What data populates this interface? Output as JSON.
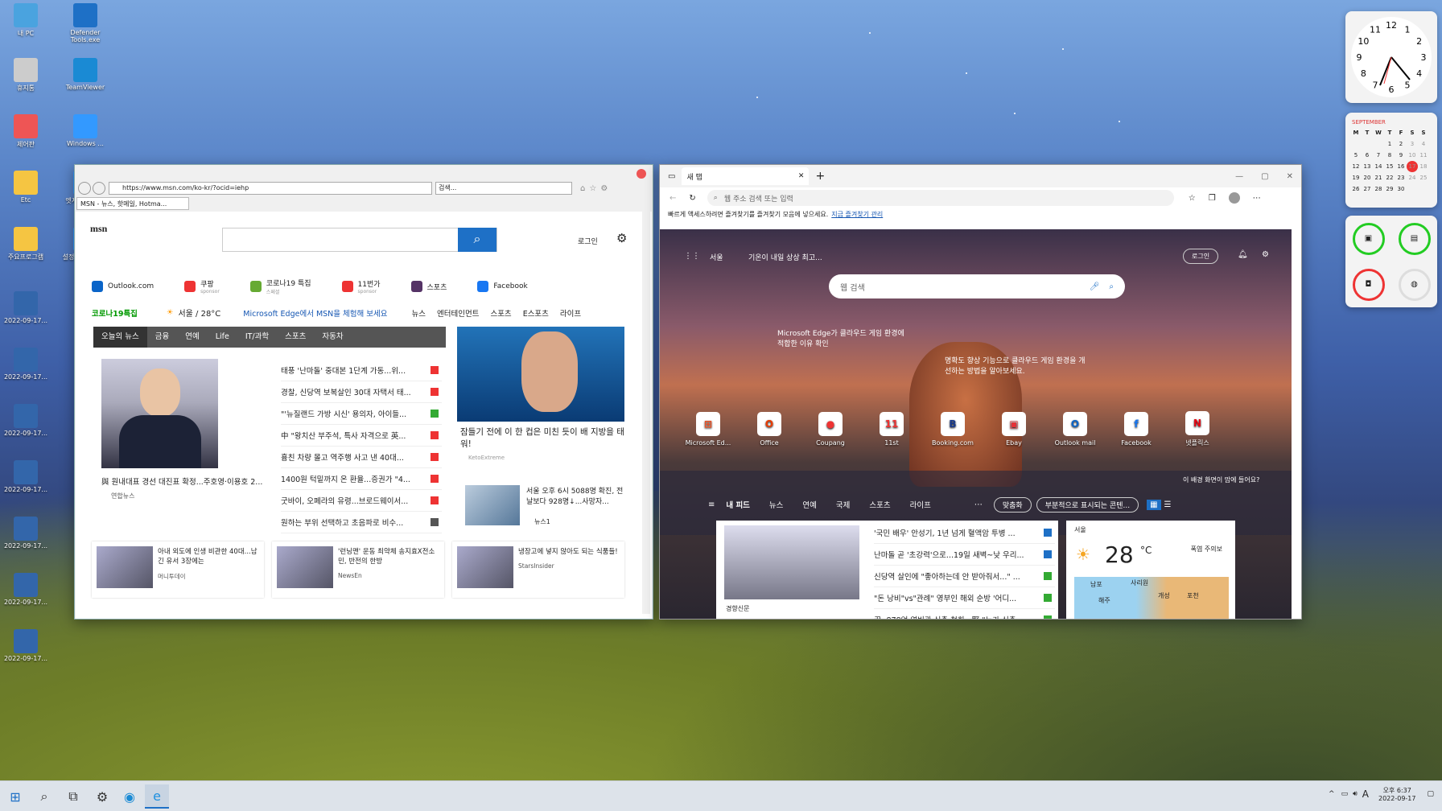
{
  "desktop": {
    "icons": [
      "내 PC",
      "Defender Tools.exe",
      "휴지통",
      "TeamViewer",
      "제어판",
      "Windows ...",
      "Etc",
      "엣지 주 포터블",
      "주요프로그램",
      "설정 및 유지관리",
      "2022-09-17...",
      "2022-09-17...",
      "2022-09-17...",
      "2022-09-17...",
      "2022-09-17...",
      "2022-09-17...",
      "2022-09-17..."
    ]
  },
  "ie": {
    "url": "https://www.msn.com/ko-kr/?ocid=iehp",
    "search_placeholder": "검색...",
    "tab_title": "MSN - 뉴스, 핫메일, Hotma...",
    "logo": "msn",
    "signin": "로그인",
    "shortcuts": [
      "Outlook.com",
      "쿠팡",
      "코로나19 특집",
      "11번가",
      "스포츠",
      "Facebook"
    ],
    "shortcut_subs": [
      "",
      "sponsor",
      "스페셜",
      "sponsor",
      "",
      ""
    ],
    "topic": "코로나19특집",
    "weather": "서울 / 28°C",
    "promo": "Microsoft Edge에서 MSN을 체험해 보세요",
    "nav": [
      "뉴스",
      "엔터테인먼트",
      "스포츠",
      "E스포츠",
      "라이프"
    ],
    "tabs": [
      "오늘의 뉴스",
      "금융",
      "연예",
      "Life",
      "IT/과학",
      "스포츠",
      "자동차"
    ],
    "headline": "與 원내대표 경선 대진표 확정...주호영·이용호 2...",
    "headline_src": "연합뉴스",
    "news": [
      "태풍 '난마돌' 중대본 1단계 가동...위...",
      "경찰, 신당역 보복살인 30대 자택서 태...",
      "\"'뉴질랜드 가방 시신' 용의자, 아이들...",
      "中 \"왕치산 부주석, 특사 자격으로 英...",
      "흉친 차량 몰고 역주행 사고 낸 40대...",
      "1400원 턱밑까지 온 환율...증권가 \"4...",
      "굿바이, 오페라의 유령...브로드웨이서...",
      "원하는 부위 선택하고 초음파로 비수..."
    ],
    "ad_title": "잠들기 전에 이 한 컵은 미친 듯이 배 지방을 태워!",
    "ad_src": "KetoExtreme",
    "side_news": "서울 오후 6시 5088명 확진, 전날보다 928명↓...사망자...",
    "side_src": "뉴스1",
    "cards": [
      {
        "t": "아내 외도에 인생 비관한 40대...남긴 유서 3장에는",
        "s": "머니투데이"
      },
      {
        "t": "'런닝맨' 운동 최약체 송지효X전소민, 반전의 한방",
        "s": "NewsEn"
      },
      {
        "t": "냉장고에 넣지 않아도 되는 식품들!",
        "s": "StarsInsider"
      }
    ]
  },
  "edge": {
    "tab": "새 탭",
    "address_placeholder": "웹 주소 검색 또는 입력",
    "favbar": "빠르게 액세스하려면 즐겨찾기를 즐겨찾기 모음에 넣으세요.",
    "favbar_link": "지금 즐겨찾기 관리",
    "location": "서울",
    "alert": "기온이 내일 상상 최고...",
    "signin": "로그인",
    "search_placeholder": "웹 검색",
    "tip1": "Microsoft Edge가 클라우드 게임 환경에 적합한 이유 확인",
    "tip2": "명확도 향상 기능으로 클라우드 게임 환경을 개선하는 방법을 알아보세요.",
    "favs": [
      "Microsoft Ed...",
      "Office",
      "Coupang",
      "11st",
      "Booking.com",
      "Ebay",
      "Outlook mail",
      "Facebook",
      "넷플릭스"
    ],
    "bg_link": "이 배경 화면이 맘에 들어요?",
    "feed_tabs": [
      "내 피드",
      "뉴스",
      "연예",
      "국제",
      "스포츠",
      "라이프"
    ],
    "personalize": "맞춤화",
    "content_sel": "부분적으로 표시되는 콘텐...",
    "news": [
      "'국민 배우' 안성기, 1년 넘게 혈액암 투병 ...",
      "난마돌 곧 '초강력'으로...19일 새벽~낮 우리...",
      "신당역 살인에 \"좋아하는데 안 받아줘서...\" ...",
      "\"돈 낭비\"vs\"관례\" 영부인 해외 순방 '어디...",
      "尹, 878억 영빈관 신축 철회...野 \"누가 신축 ..."
    ],
    "news_src": "경향신문",
    "weather_city": "서울",
    "temp": "28",
    "unit": "°C",
    "warn": "폭염 주의보",
    "map_labels": [
      "남포",
      "사리원",
      "개성",
      "포천",
      "해주"
    ]
  },
  "widgets": {
    "clock_nums": [
      "12",
      "1",
      "2",
      "3",
      "4",
      "5",
      "6",
      "7",
      "8",
      "9",
      "10",
      "11"
    ],
    "month": "SEPTEMBER",
    "days": [
      "M",
      "T",
      "W",
      "T",
      "F",
      "S",
      "S"
    ],
    "cal": [
      [
        "",
        "",
        "",
        "1",
        "2",
        "3",
        "4"
      ],
      [
        "5",
        "6",
        "7",
        "8",
        "9",
        "10",
        "11"
      ],
      [
        "12",
        "13",
        "14",
        "15",
        "16",
        "17",
        "18"
      ],
      [
        "19",
        "20",
        "21",
        "22",
        "23",
        "24",
        "25"
      ],
      [
        "26",
        "27",
        "28",
        "29",
        "30",
        "",
        ""
      ]
    ]
  },
  "taskbar": {
    "time": "오후 6:37",
    "date": "2022-09-17",
    "lang": "A"
  }
}
